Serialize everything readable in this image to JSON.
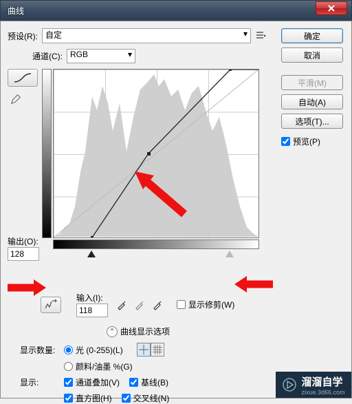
{
  "titlebar": {
    "title": "曲线"
  },
  "preset": {
    "label": "预设(R):",
    "value": "自定"
  },
  "channel": {
    "label": "通道(C):",
    "value": "RGB"
  },
  "buttons": {
    "ok": "确定",
    "cancel": "取消",
    "smooth": "平滑(M)",
    "auto": "自动(A)",
    "options": "选项(T)..."
  },
  "preview": {
    "label": "预览(P)",
    "checked": true
  },
  "output": {
    "label": "输出(O):",
    "value": "128"
  },
  "input": {
    "label": "输入(I):",
    "value": "118"
  },
  "clip": {
    "label": "显示修剪(W)",
    "checked": false
  },
  "expander": {
    "label": "曲线显示选项"
  },
  "display_amount": {
    "label": "显示数量:",
    "light": "光 (0-255)(L)",
    "pigment": "颜料/油墨 %(G)"
  },
  "show": {
    "label": "显示:",
    "channel_overlay": "通道叠加(V)",
    "baseline": "基线(B)",
    "histogram": "直方图(H)",
    "intersection": "交叉线(N)"
  },
  "watermark": {
    "main": "溜溜自学",
    "sub": "zixue.3d66.com"
  },
  "chart_data": {
    "type": "line",
    "title": "Curves",
    "xlabel": "Input",
    "ylabel": "Output",
    "xlim": [
      0,
      255
    ],
    "ylim": [
      0,
      255
    ],
    "series": [
      {
        "name": "curve",
        "x": [
          0,
          48,
          118,
          220,
          255
        ],
        "y": [
          0,
          0,
          128,
          255,
          255
        ]
      }
    ],
    "control_point": {
      "input": 118,
      "output": 128
    },
    "black_slider": 48,
    "white_slider": 220
  }
}
